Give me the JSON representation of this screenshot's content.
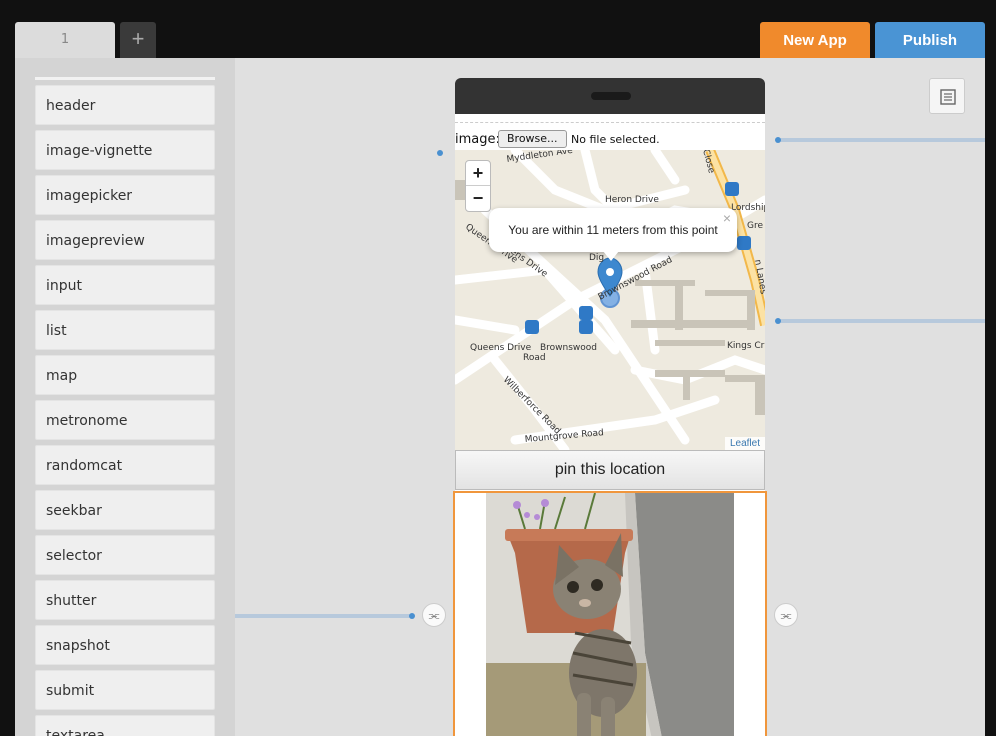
{
  "tabs": [
    {
      "label": "1"
    }
  ],
  "add_tab_label": "+",
  "actions": {
    "new_app": "New App",
    "publish": "Publish"
  },
  "sidebar": {
    "items": [
      {
        "label": "header"
      },
      {
        "label": "image-vignette"
      },
      {
        "label": "imagepicker"
      },
      {
        "label": "imagepreview"
      },
      {
        "label": "input"
      },
      {
        "label": "list"
      },
      {
        "label": "map"
      },
      {
        "label": "metronome"
      },
      {
        "label": "randomcat"
      },
      {
        "label": "seekbar"
      },
      {
        "label": "selector"
      },
      {
        "label": "shutter"
      },
      {
        "label": "snapshot"
      },
      {
        "label": "submit"
      },
      {
        "label": "textarea"
      }
    ]
  },
  "phone": {
    "file_input": {
      "label": "image:",
      "button": "Browse...",
      "status": "No file selected."
    },
    "map": {
      "zoom_in": "+",
      "zoom_out": "−",
      "popup_text": "You are within 11 meters from this point",
      "popup_close": "×",
      "attribution": "Leaflet",
      "street_labels": [
        "Myddleton Ave",
        "Heron Drive",
        "Queens Drive",
        "Queens Drive",
        "Brownswood Road",
        "Queens Drive Brownswood",
        "Road",
        "Wilberforce Road",
        "Mountgrove Road",
        "Kings Cr",
        "Lordship Park",
        "Gre",
        "Close",
        "n Lanes",
        "Dig"
      ]
    },
    "pin_button": "pin this location"
  },
  "colors": {
    "new_app": "#f08a2c",
    "publish": "#4a94d4",
    "selected_border": "#f0963c",
    "wire": "#b7c9dc"
  }
}
